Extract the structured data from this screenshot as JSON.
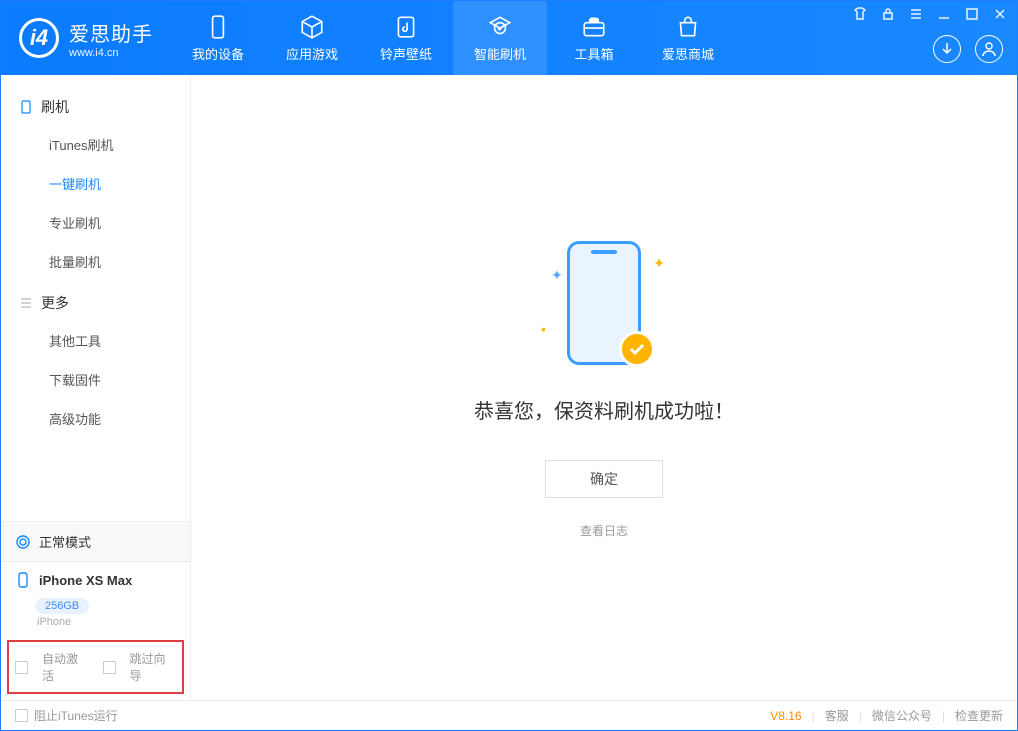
{
  "app": {
    "title": "爱思助手",
    "subtitle": "www.i4.cn"
  },
  "nav": {
    "items": [
      {
        "label": "我的设备",
        "icon": "phone"
      },
      {
        "label": "应用游戏",
        "icon": "cube"
      },
      {
        "label": "铃声壁纸",
        "icon": "music"
      },
      {
        "label": "智能刷机",
        "icon": "refresh",
        "active": true
      },
      {
        "label": "工具箱",
        "icon": "toolbox"
      },
      {
        "label": "爱思商城",
        "icon": "bag"
      }
    ]
  },
  "sidebar": {
    "group1": {
      "title": "刷机",
      "items": [
        "iTunes刷机",
        "一键刷机",
        "专业刷机",
        "批量刷机"
      ],
      "activeIndex": 1
    },
    "group2": {
      "title": "更多",
      "items": [
        "其他工具",
        "下载固件",
        "高级功能"
      ]
    }
  },
  "device": {
    "mode": "正常模式",
    "name": "iPhone XS Max",
    "capacity": "256GB",
    "type": "iPhone"
  },
  "options": {
    "auto_activate": "自动激活",
    "skip_guide": "跳过向导"
  },
  "main": {
    "success": "恭喜您，保资料刷机成功啦！",
    "ok": "确定",
    "view_log": "查看日志"
  },
  "statusbar": {
    "block_itunes": "阻止iTunes运行",
    "version": "V8.16",
    "links": [
      "客服",
      "微信公众号",
      "检查更新"
    ]
  }
}
